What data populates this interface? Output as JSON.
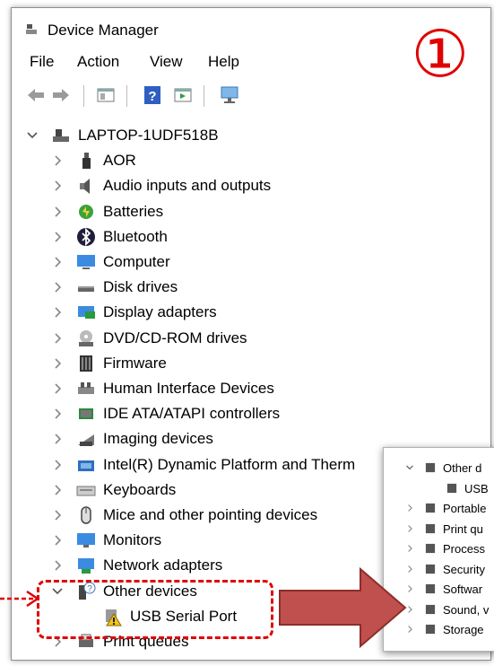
{
  "window": {
    "title": "Device Manager"
  },
  "menu": [
    "File",
    "Action",
    "View",
    "Help"
  ],
  "badge": "①",
  "tree": {
    "root": "LAPTOP-1UDF518B",
    "items": [
      {
        "label": "AOR",
        "icon": "tag-icon"
      },
      {
        "label": "Audio inputs and outputs",
        "icon": "speaker-icon"
      },
      {
        "label": "Batteries",
        "icon": "battery-icon"
      },
      {
        "label": "Bluetooth",
        "icon": "bluetooth-icon"
      },
      {
        "label": "Computer",
        "icon": "computer-icon"
      },
      {
        "label": "Disk drives",
        "icon": "disk-icon"
      },
      {
        "label": "Display adapters",
        "icon": "display-icon"
      },
      {
        "label": "DVD/CD-ROM drives",
        "icon": "dvd-icon"
      },
      {
        "label": "Firmware",
        "icon": "firmware-icon"
      },
      {
        "label": "Human Interface Devices",
        "icon": "hid-icon"
      },
      {
        "label": "IDE ATA/ATAPI controllers",
        "icon": "ide-icon"
      },
      {
        "label": "Imaging devices",
        "icon": "camera-icon"
      },
      {
        "label": "Intel(R) Dynamic Platform and Therm",
        "icon": "intel-icon"
      },
      {
        "label": "Keyboards",
        "icon": "keyboard-icon"
      },
      {
        "label": "Mice and other pointing devices",
        "icon": "mouse-icon"
      },
      {
        "label": "Monitors",
        "icon": "monitor-icon"
      },
      {
        "label": "Network adapters",
        "icon": "network-icon"
      },
      {
        "label": "Other devices",
        "icon": "unknown-device-icon",
        "expanded": true
      },
      {
        "label": "USB Serial Port",
        "icon": "warning-device-icon",
        "child": true
      },
      {
        "label": "Print queues",
        "icon": "printer-icon"
      }
    ]
  },
  "inset": {
    "items": [
      {
        "label": "Other d",
        "expanded": true
      },
      {
        "label": "USB",
        "child": true
      },
      {
        "label": "Portable"
      },
      {
        "label": "Print qu"
      },
      {
        "label": "Process"
      },
      {
        "label": "Security"
      },
      {
        "label": "Softwar"
      },
      {
        "label": "Sound, v"
      },
      {
        "label": "Storage"
      }
    ]
  },
  "colors": {
    "annotation": "#e00000",
    "arrow": "#c0504d",
    "arrow_border": "#8b2e2b"
  }
}
